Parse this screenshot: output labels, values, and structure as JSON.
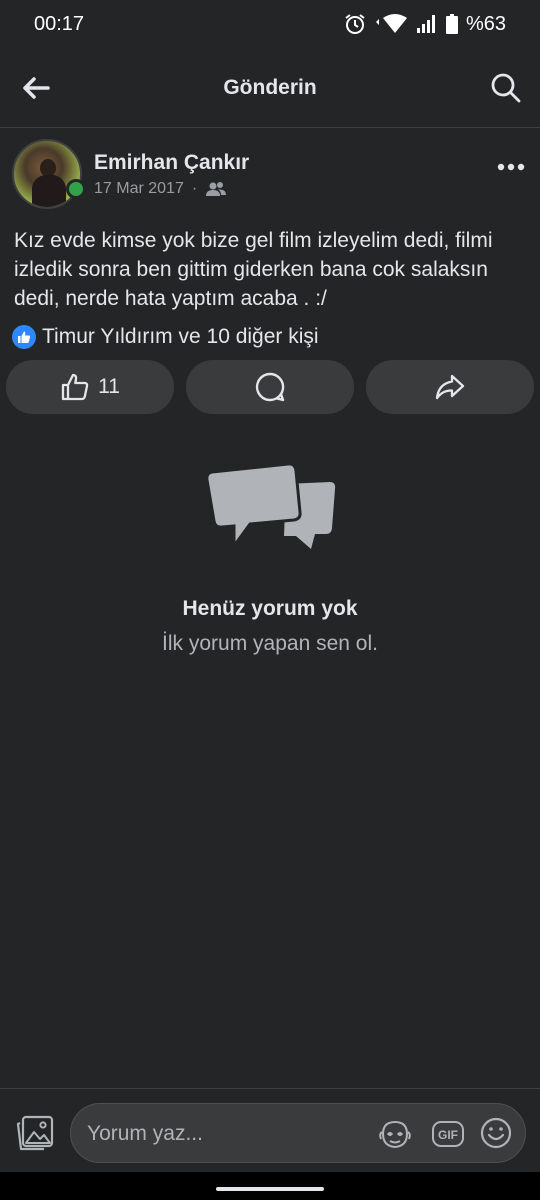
{
  "status_bar": {
    "time": "00:17",
    "battery": "%63",
    "icons": [
      "alarm-icon",
      "wifi-icon",
      "signal-icon",
      "battery-icon"
    ]
  },
  "topnav": {
    "title": "Gönderin",
    "back_icon": "arrow-left-icon",
    "search_icon": "search-icon"
  },
  "post": {
    "author": "Emirhan Çankır",
    "date": "17 Mar 2017",
    "separator": "·",
    "audience_icon": "friends-icon",
    "text": "Kız evde kimse yok bize gel film izleyelim dedi, filmi izledik sonra ben gittim giderken bana cok salaksın dedi, nerde hata yaptım acaba . :/",
    "reactions_text": "Timur Yıldırım ve 10 diğer kişi",
    "like_count": "11"
  },
  "empty_state": {
    "title": "Henüz yorum yok",
    "subtitle": "İlk yorum yapan sen ol."
  },
  "composer": {
    "placeholder": "Yorum yaz...",
    "gif_label": "GIF"
  },
  "colors": {
    "background": "#242526",
    "surface": "#3a3b3c",
    "text_primary": "#e4e6eb",
    "text_secondary": "#b0b3b8",
    "online": "#31a24c",
    "like_blue": "#2d88ff"
  }
}
